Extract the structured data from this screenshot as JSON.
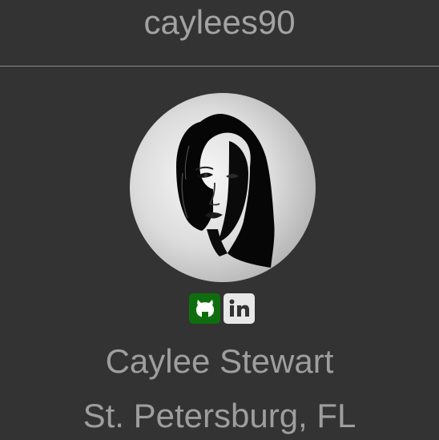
{
  "header": {
    "username": "caylees90"
  },
  "profile": {
    "avatar_icon": "profile-portrait",
    "name": "Caylee Stewart",
    "location": "St. Petersburg, FL"
  },
  "socials": [
    {
      "icon": "github-icon",
      "color": "#0e6e0e"
    },
    {
      "icon": "linkedin-icon",
      "label": "in",
      "color": "#e8e8e8"
    }
  ]
}
